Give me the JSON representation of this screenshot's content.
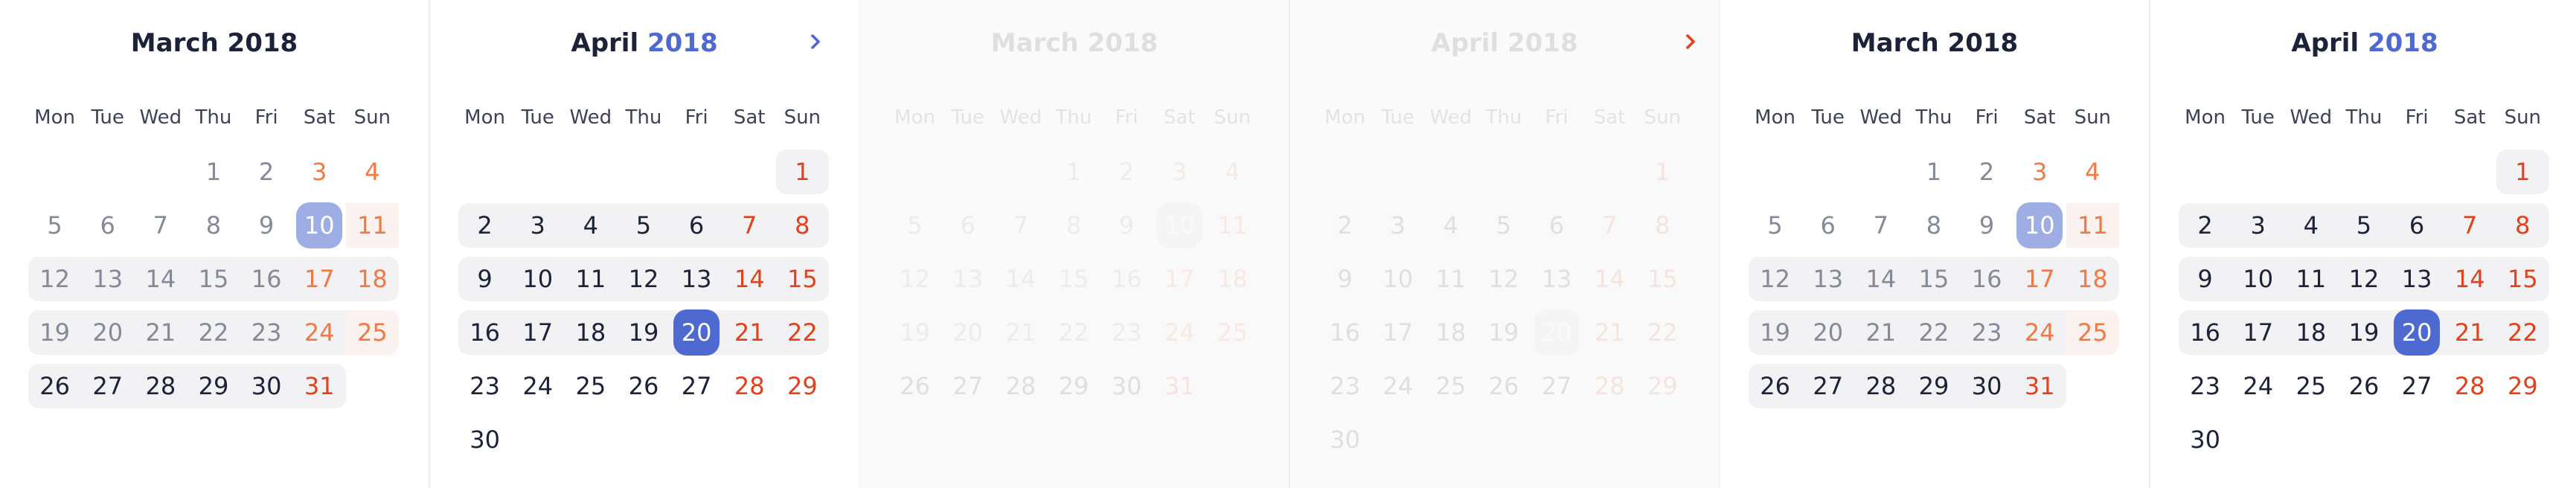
{
  "colors": {
    "accent": "#4e6ad0",
    "accent_light": "#9eaee5",
    "weekend_march": "#f07a45",
    "weekend_april": "#e0421b",
    "text_dark": "#1c2238",
    "text_muted": "#858a99",
    "range_bg": "#f2f2f4"
  },
  "weekdays": [
    "Mon",
    "Tue",
    "Wed",
    "Thu",
    "Fri",
    "Sat",
    "Sun"
  ],
  "calendars": [
    {
      "month_label": "March",
      "year_label": "2018",
      "year_accent": false,
      "show_next": false,
      "faded": false,
      "selected_day": "10",
      "selected_style": "light",
      "rows": [
        [
          "",
          "",
          "",
          "1",
          "2",
          "3",
          "4"
        ],
        [
          "5",
          "6",
          "7",
          "8",
          "9",
          "10",
          "11"
        ],
        [
          "12",
          "13",
          "14",
          "15",
          "16",
          "17",
          "18"
        ],
        [
          "19",
          "20",
          "21",
          "22",
          "23",
          "24",
          "25"
        ],
        [
          "26",
          "27",
          "28",
          "29",
          "30",
          "31",
          ""
        ]
      ]
    },
    {
      "month_label": "April",
      "year_label": "2018",
      "year_accent": true,
      "show_next": true,
      "next_icon": "chevron-right-icon",
      "faded": false,
      "selected_day": "20",
      "selected_style": "dark",
      "rows": [
        [
          "",
          "",
          "",
          "",
          "",
          "",
          "1"
        ],
        [
          "2",
          "3",
          "4",
          "5",
          "6",
          "7",
          "8"
        ],
        [
          "9",
          "10",
          "11",
          "12",
          "13",
          "14",
          "15"
        ],
        [
          "16",
          "17",
          "18",
          "19",
          "20",
          "21",
          "22"
        ],
        [
          "23",
          "24",
          "25",
          "26",
          "27",
          "28",
          "29"
        ],
        [
          "30",
          "",
          "",
          "",
          "",
          "",
          ""
        ]
      ]
    },
    {
      "month_label": "March",
      "year_label": "2018",
      "year_accent": false,
      "show_next": false,
      "faded": true,
      "selected_day": "10",
      "selected_style": "grey",
      "rows": [
        [
          "",
          "",
          "",
          "1",
          "2",
          "3",
          "4"
        ],
        [
          "5",
          "6",
          "7",
          "8",
          "9",
          "10",
          "11"
        ],
        [
          "12",
          "13",
          "14",
          "15",
          "16",
          "17",
          "18"
        ],
        [
          "19",
          "20",
          "21",
          "22",
          "23",
          "24",
          "25"
        ],
        [
          "26",
          "27",
          "28",
          "29",
          "30",
          "31",
          ""
        ]
      ]
    },
    {
      "month_label": "April",
      "year_label": "2018",
      "year_accent": false,
      "show_next": true,
      "next_icon": "chevron-right-icon",
      "faded": true,
      "selected_day": "20",
      "selected_style": "grey",
      "rows": [
        [
          "",
          "",
          "",
          "",
          "",
          "",
          "1"
        ],
        [
          "2",
          "3",
          "4",
          "5",
          "6",
          "7",
          "8"
        ],
        [
          "9",
          "10",
          "11",
          "12",
          "13",
          "14",
          "15"
        ],
        [
          "16",
          "17",
          "18",
          "19",
          "20",
          "21",
          "22"
        ],
        [
          "23",
          "24",
          "25",
          "26",
          "27",
          "28",
          "29"
        ],
        [
          "30",
          "",
          "",
          "",
          "",
          "",
          ""
        ]
      ]
    },
    {
      "month_label": "March",
      "year_label": "2018",
      "year_accent": false,
      "show_next": false,
      "faded": false,
      "selected_day": "10",
      "selected_style": "light",
      "rows": [
        [
          "",
          "",
          "",
          "1",
          "2",
          "3",
          "4"
        ],
        [
          "5",
          "6",
          "7",
          "8",
          "9",
          "10",
          "11"
        ],
        [
          "12",
          "13",
          "14",
          "15",
          "16",
          "17",
          "18"
        ],
        [
          "19",
          "20",
          "21",
          "22",
          "23",
          "24",
          "25"
        ],
        [
          "26",
          "27",
          "28",
          "29",
          "30",
          "31",
          ""
        ]
      ]
    },
    {
      "month_label": "April",
      "year_label": "2018",
      "year_accent": true,
      "show_next": false,
      "faded": false,
      "selected_day": "20",
      "selected_style": "dark",
      "rows": [
        [
          "",
          "",
          "",
          "",
          "",
          "",
          "1"
        ],
        [
          "2",
          "3",
          "4",
          "5",
          "6",
          "7",
          "8"
        ],
        [
          "9",
          "10",
          "11",
          "12",
          "13",
          "14",
          "15"
        ],
        [
          "16",
          "17",
          "18",
          "19",
          "20",
          "21",
          "22"
        ],
        [
          "23",
          "24",
          "25",
          "26",
          "27",
          "28",
          "29"
        ],
        [
          "30",
          "",
          "",
          "",
          "",
          "",
          ""
        ]
      ]
    }
  ]
}
